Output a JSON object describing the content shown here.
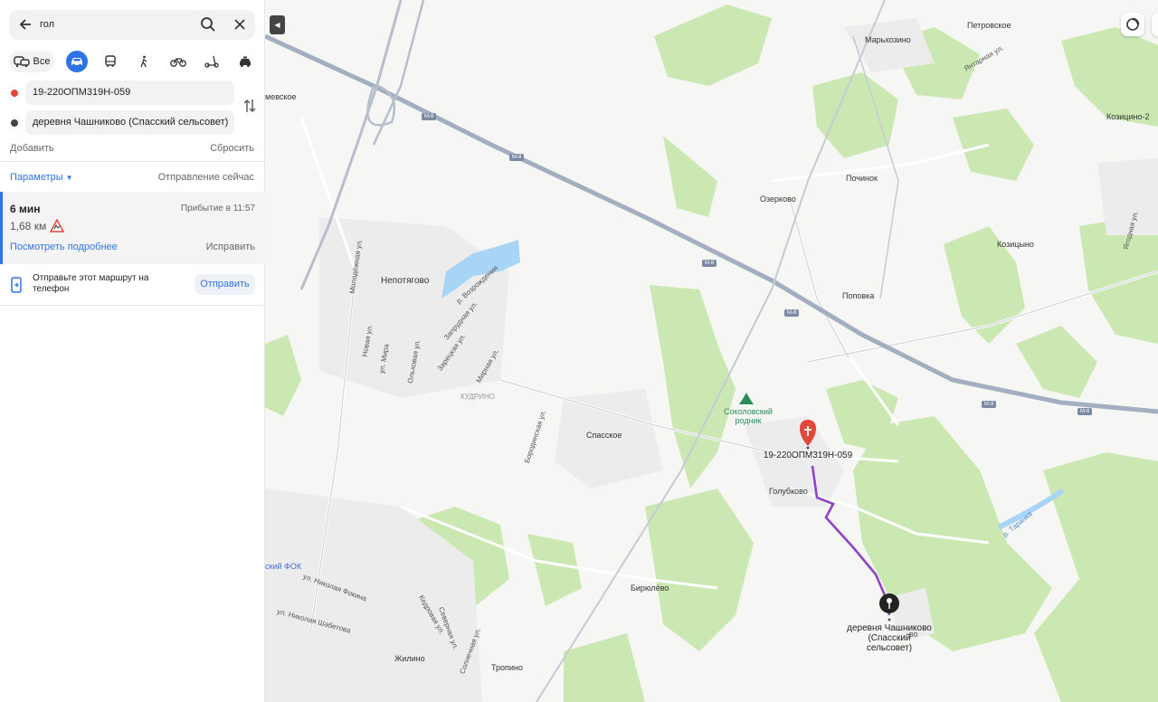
{
  "search": {
    "query": "гол"
  },
  "modes": {
    "all_label": "Все"
  },
  "route_points": {
    "from": "19-220ОПМ319Н-059",
    "to": "деревня Чашниково (Спасский сельсовет)"
  },
  "actions": {
    "add": "Добавить",
    "reset": "Сбросить"
  },
  "options": {
    "params": "Параметры",
    "depart": "Отправление сейчас"
  },
  "route": {
    "time": "6 мин",
    "arrival": "Прибытие в 11:57",
    "distance": "1,68 км",
    "details": "Посмотреть подробнее",
    "fix": "Исправить"
  },
  "send": {
    "text": "Отправьте этот маршрут на телефон",
    "button": "Отправить"
  },
  "map": {
    "highway": "М-8",
    "places": {
      "petrovskoe": "Петровское",
      "markhozino": "Марьхозино",
      "kozitsino2": "Козицино-2",
      "pochinok": "Починок",
      "ozerkovo": "Озерково",
      "kozitsyno": "Козицыно",
      "nepotyagovo": "Непотягово",
      "popovka": "Поповка",
      "kudrino": "КУДРИНО",
      "spasskoe": "Спасское",
      "golubkovo": "Голубково",
      "biryulevo": "Бирюлёво",
      "tropino": "Тропино",
      "zhilino": "Жилино",
      "fok": "ский ФОК",
      "mevskoe": "мевское"
    },
    "poi": {
      "spring": "Соколовский родник"
    },
    "pin_from": "19-220ОПМ319Н-059",
    "pin_to": "деревня Чашниково (Спасский сельсовет)",
    "pin_to_suffix": "во",
    "streets": {
      "molodezh": "Молодёжная ул.",
      "vozr": "р. Возрождения",
      "zareg": "Зарецкая ул.",
      "zaprud": "Запрудная ул.",
      "mirn": "Мирная ул.",
      "borod": "Бородинская ул.",
      "taranka": "р. Таранка",
      "yantar": "Янтарная ул.",
      "yagod": "Ягодная ул.",
      "nfokina": "ул. Николая Фокина",
      "nshabet": "ул. Николая Шабетова",
      "kedr": "Кедровая ул.",
      "sever": "Северная ул.",
      "soln": "Солнечная ул.",
      "novaya": "Новая ул.",
      "mira": "ул. Мира",
      "olkh": "Ольховая ул."
    },
    "route_color": "#8e44c9",
    "water_color": "#a8d4f5",
    "forest_color": "#cbe8b3"
  }
}
